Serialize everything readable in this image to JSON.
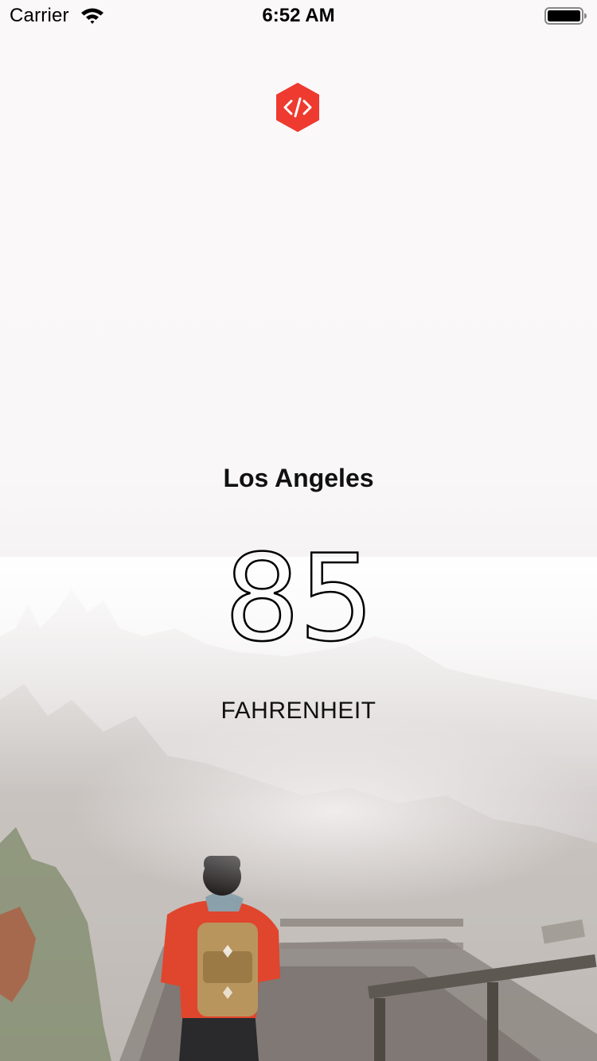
{
  "status_bar": {
    "carrier": "Carrier",
    "time": "6:52 AM",
    "wifi_icon": "wifi-icon",
    "battery_icon": "battery-full-icon"
  },
  "app": {
    "logo_icon": "code-hexagon-icon",
    "logo_color": "#ee3a2f"
  },
  "weather": {
    "city": "Los Angeles",
    "temperature": "85",
    "unit": "FAHRENHEIT"
  },
  "background": {
    "description_icon": "foggy-boardwalk-photo"
  }
}
